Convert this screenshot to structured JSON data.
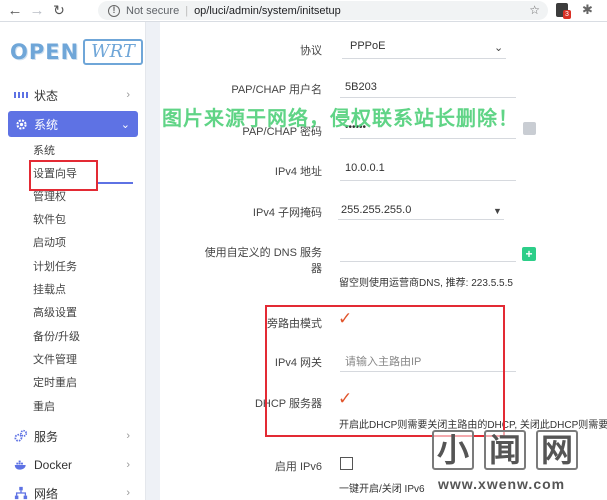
{
  "browser": {
    "security_label": "Not secure",
    "url": "op/luci/admin/system/initsetup",
    "badge": "3"
  },
  "logo": {
    "part1": "OPEN",
    "part2": "WRT"
  },
  "sidebar": {
    "status": "状态",
    "system": "系统",
    "system_sub": [
      "系统",
      "设置向导",
      "管理权",
      "软件包",
      "启动项",
      "计划任务",
      "挂载点",
      "高级设置",
      "备份/升级",
      "文件管理",
      "定时重启",
      "重启"
    ],
    "services": "服务",
    "docker": "Docker",
    "network": "网络"
  },
  "form": {
    "protocol_label": "协议",
    "protocol_value": "PPPoE",
    "user_label": "PAP/CHAP 用户名",
    "user_value": "5B203",
    "pass_label": "PAP/CHAP 密码",
    "pass_value": "••••••",
    "ipv4_label": "IPv4 地址",
    "ipv4_value": "10.0.0.1",
    "mask_label": "IPv4 子网掩码",
    "mask_value": "255.255.255.0",
    "dns_label": "使用自定义的 DNS 服务器",
    "dns_hint": "留空则使用运营商DNS, 推荐: 223.5.5.5",
    "bypass_label": "旁路由模式",
    "gateway_label": "IPv4 网关",
    "gateway_placeholder": "请输入主路由IP",
    "dhcp_label": "DHCP 服务器",
    "dhcp_hint": "开启此DHCP则需要关闭主路由的DHCP, 关闭此DHCP则需要手动将",
    "ipv6_label": "启用 IPv6",
    "ipv6_hint": "一键开启/关闭 IPv6"
  },
  "watermark": {
    "text": "图片来源于网络，侵权联系站长删除！",
    "site_cn": [
      "小",
      "闻",
      "网"
    ],
    "site_url": "www.xwenw.com"
  },
  "colors": {
    "accent": "#5e72e4",
    "red_box": "#e32a34",
    "check": "#e1552c",
    "green": "#2dce89"
  }
}
